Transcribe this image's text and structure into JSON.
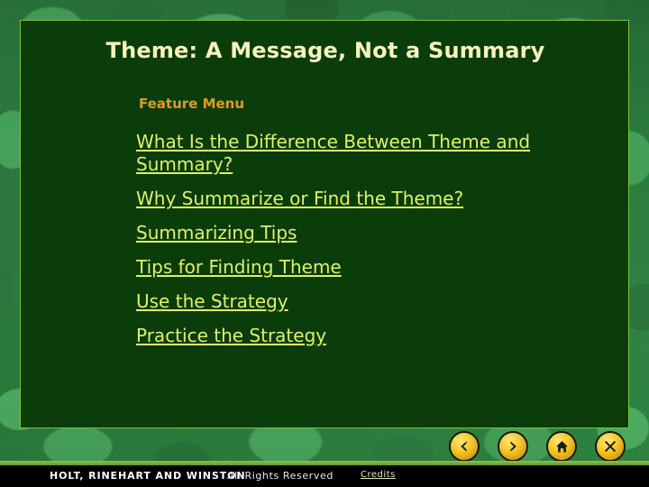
{
  "slide": {
    "title": "Theme: A Message, Not a Summary",
    "section_label": "Feature Menu",
    "menu_items": [
      {
        "label": "What Is the Difference Between Theme and Summary?"
      },
      {
        "label": "Why Summarize or Find the Theme?"
      },
      {
        "label": "Summarizing Tips"
      },
      {
        "label": "Tips for Finding Theme"
      },
      {
        "label": "Use the Strategy"
      },
      {
        "label": "Practice the Strategy"
      }
    ]
  },
  "footer": {
    "brand": "HOLT, RINEHART AND WINSTON",
    "rights": "All Rights Reserved",
    "credits": "Credits"
  },
  "nav": {
    "buttons": [
      {
        "label": "Previous",
        "icon": "chevron-left-icon"
      },
      {
        "label": "Next",
        "icon": "chevron-right-icon"
      },
      {
        "label": "Collection\nMenu",
        "icon": "home-icon"
      },
      {
        "label": "Exit",
        "icon": "close-x-icon"
      }
    ]
  },
  "colors": {
    "panel_bg": "#0b3d0b",
    "panel_border": "#7fbf3f",
    "title_text": "#f6f3bd",
    "section_label": "#e09a20",
    "link_text": "#dff06a",
    "footer_bg": "#000000",
    "button_gold": "#f5c328",
    "background_green": "#35904a"
  }
}
